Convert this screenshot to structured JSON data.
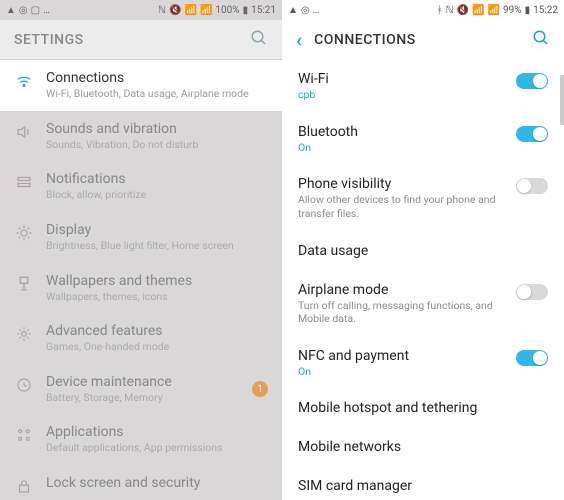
{
  "left": {
    "statusbar": {
      "battery": "100%",
      "time": "15:21"
    },
    "appbar_title": "SETTINGS",
    "items": [
      {
        "title": "Connections",
        "sub": "Wi-Fi, Bluetooth, Data usage, Airplane mode",
        "selected": true
      },
      {
        "title": "Sounds and vibration",
        "sub": "Sounds, Vibration, Do not disturb"
      },
      {
        "title": "Notifications",
        "sub": "Block, allow, prioritize"
      },
      {
        "title": "Display",
        "sub": "Brightness, Blue light filter, Home screen"
      },
      {
        "title": "Wallpapers and themes",
        "sub": "Wallpapers, themes, icons"
      },
      {
        "title": "Advanced features",
        "sub": "Games, One-handed mode"
      },
      {
        "title": "Device maintenance",
        "sub": "Battery, Storage, Memory",
        "badge": "1"
      },
      {
        "title": "Applications",
        "sub": "Default applications, App permissions"
      },
      {
        "title": "Lock screen and security",
        "sub": ""
      }
    ]
  },
  "right": {
    "statusbar": {
      "battery": "99%",
      "time": "15:22"
    },
    "appbar_title": "CONNECTIONS",
    "items": [
      {
        "title": "Wi-Fi",
        "sub": "cpb",
        "accent": true,
        "toggle": "on"
      },
      {
        "title": "Bluetooth",
        "sub": "On",
        "accent": true,
        "toggle": "on"
      },
      {
        "title": "Phone visibility",
        "sub": "Allow other devices to find your phone and transfer files.",
        "toggle": "off"
      },
      {
        "title": "Data usage"
      },
      {
        "title": "Airplane mode",
        "sub": "Turn off calling, messaging functions, and Mobile data.",
        "toggle": "off"
      },
      {
        "title": "NFC and payment",
        "sub": "On",
        "accent": true,
        "toggle": "on"
      },
      {
        "title": "Mobile hotspot and tethering"
      },
      {
        "title": "Mobile networks"
      },
      {
        "title": "SIM card manager"
      }
    ]
  }
}
